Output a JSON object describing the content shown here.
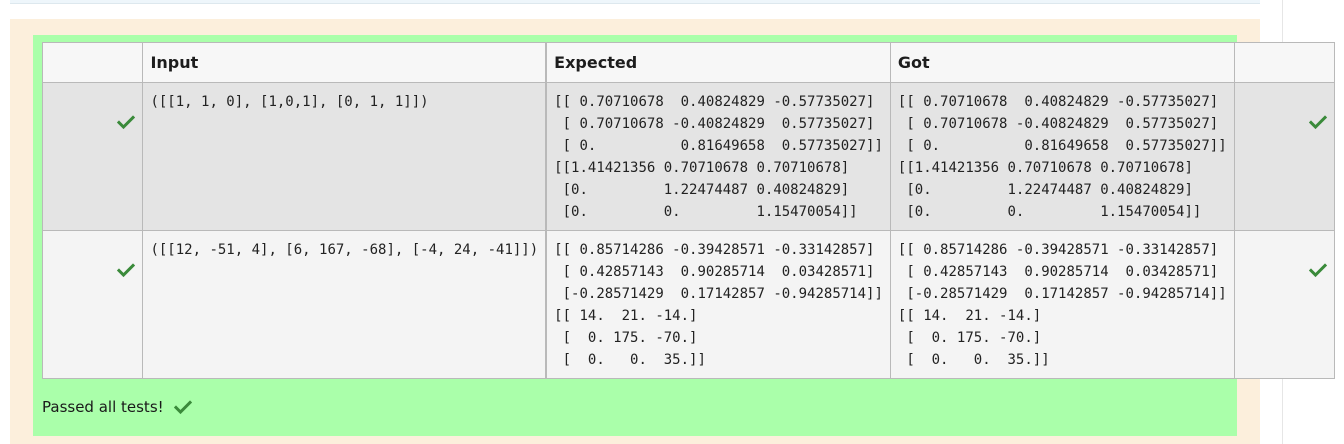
{
  "table": {
    "headers": {
      "input": "Input",
      "expected": "Expected",
      "got": "Got"
    },
    "rows": [
      {
        "input": "([[1, 1, 0], [1,0,1], [0, 1, 1]])",
        "expected": "[[ 0.70710678  0.40824829 -0.57735027]\n [ 0.70710678 -0.40824829  0.57735027]\n [ 0.          0.81649658  0.57735027]]\n[[1.41421356 0.70710678 0.70710678]\n [0.         1.22474487 0.40824829]\n [0.         0.         1.15470054]]",
        "got": "[[ 0.70710678  0.40824829 -0.57735027]\n [ 0.70710678 -0.40824829  0.57735027]\n [ 0.          0.81649658  0.57735027]]\n[[1.41421356 0.70710678 0.70710678]\n [0.         1.22474487 0.40824829]\n [0.         0.         1.15470054]]"
      },
      {
        "input": "([[12, -51, 4], [6, 167, -68], [-4, 24, -41]])",
        "expected": "[[ 0.85714286 -0.39428571 -0.33142857]\n [ 0.42857143  0.90285714  0.03428571]\n [-0.28571429  0.17142857 -0.94285714]]\n[[ 14.  21. -14.]\n [  0. 175. -70.]\n [  0.   0.  35.]]",
        "got": "[[ 0.85714286 -0.39428571 -0.33142857]\n [ 0.42857143  0.90285714  0.03428571]\n [-0.28571429  0.17142857 -0.94285714]]\n[[ 14.  21. -14.]\n [  0. 175. -70.]\n [  0.   0.  35.]]"
      }
    ]
  },
  "summary": {
    "text": "Passed all tests!"
  },
  "icons": {
    "tick": "check-icon"
  },
  "colors": {
    "pass_background": "#aaffaa",
    "outcome_background": "#fcefdc",
    "tick_green": "#3a8a3a"
  }
}
